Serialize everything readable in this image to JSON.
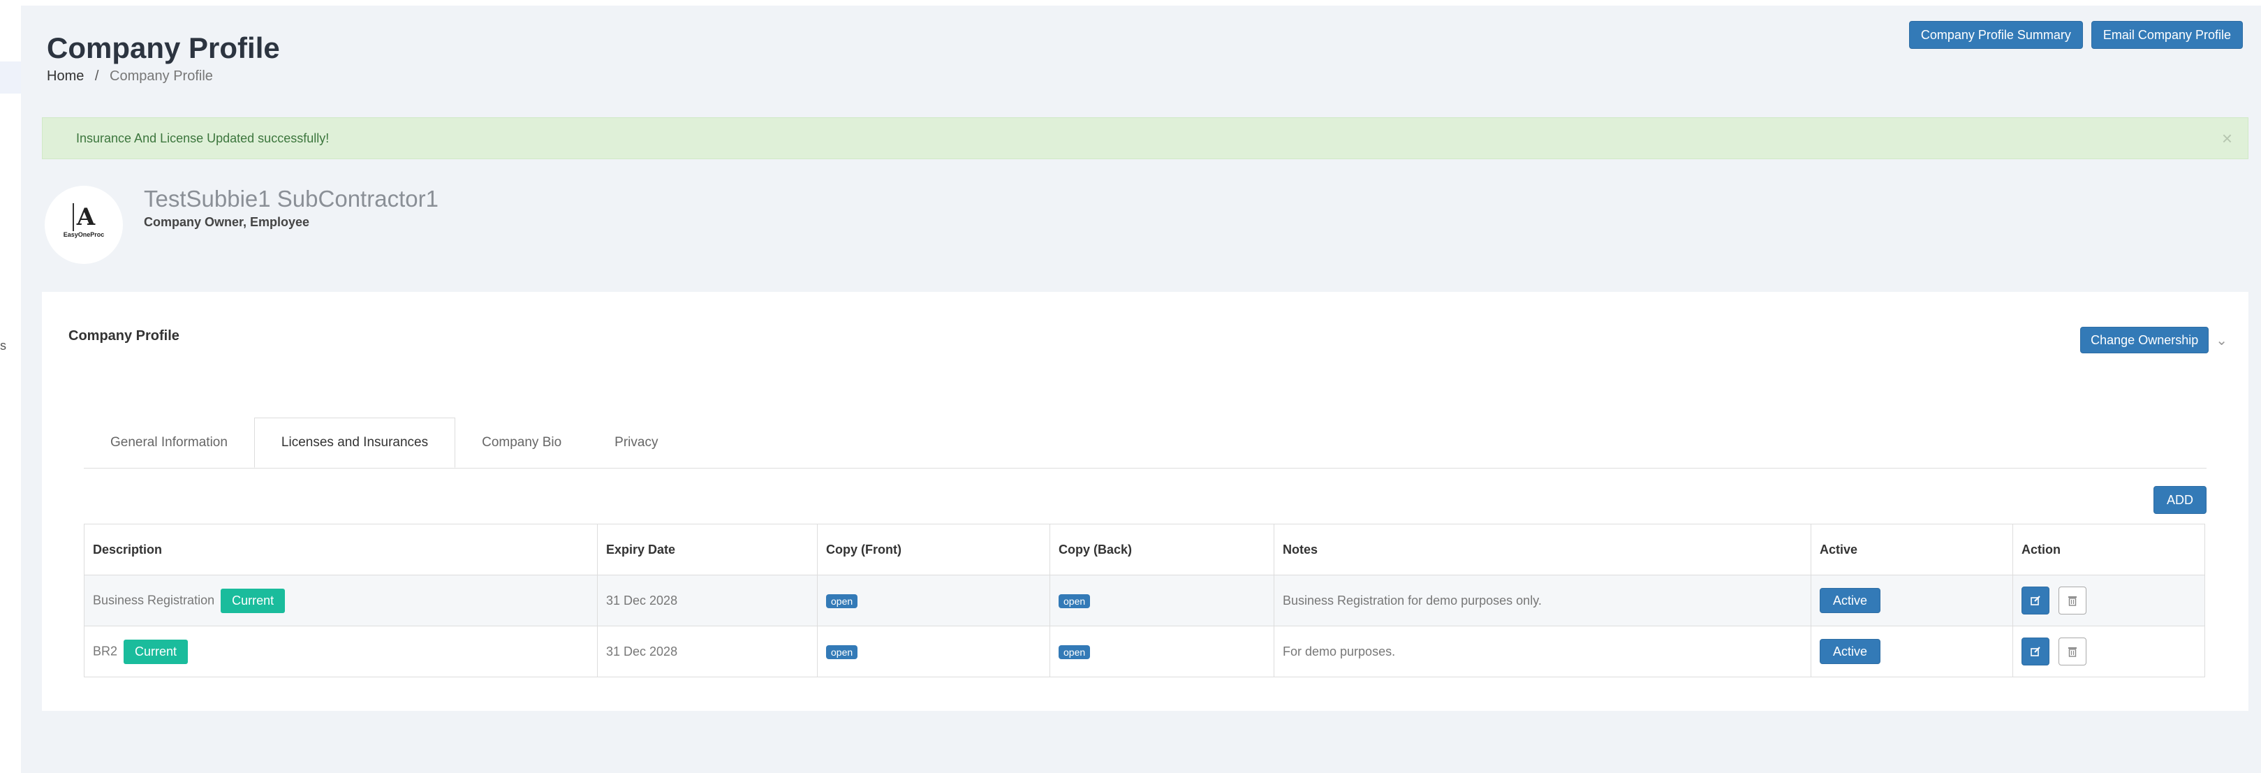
{
  "header": {
    "title": "Company Profile",
    "breadcrumb": {
      "home": "Home",
      "separator": "/",
      "current": "Company Profile"
    },
    "actions": {
      "summary": "Company Profile Summary",
      "email": "Email Company Profile"
    }
  },
  "alert": {
    "message": "Insurance And License Updated successfully!",
    "close": "×"
  },
  "sidebar": {
    "clipped_text": "s"
  },
  "user": {
    "name": "TestSubbie1 SubContractor1",
    "roles": "Company Owner, Employee",
    "logo_letter": "A",
    "logo_text": "EasyOneProc"
  },
  "panel": {
    "title": "Company Profile",
    "change_ownership": "Change Ownership",
    "chevron": "⌄"
  },
  "tabs": [
    {
      "label": "General Information"
    },
    {
      "label": "Licenses and Insurances",
      "active": true
    },
    {
      "label": "Company Bio"
    },
    {
      "label": "Privacy"
    }
  ],
  "add_label": "ADD",
  "table": {
    "headers": [
      "Description",
      "Expiry Date",
      "Copy (Front)",
      "Copy (Back)",
      "Notes",
      "Active",
      "Action"
    ],
    "rows": [
      {
        "description": "Business Registration",
        "badge": "Current",
        "expiry": "31 Dec 2028",
        "copy_front": "open",
        "copy_back": "open",
        "notes": "Business Registration for demo purposes only.",
        "active": "Active"
      },
      {
        "description": "BR2",
        "badge": "Current",
        "expiry": "31 Dec 2028",
        "copy_front": "open",
        "copy_back": "open",
        "notes": "For demo purposes.",
        "active": "Active"
      }
    ]
  },
  "colors": {
    "primary": "#337ab7",
    "success_badge": "#1abc9c",
    "alert_bg": "#dff0d8",
    "alert_text": "#3c763d",
    "page_bg": "#f0f3f7"
  }
}
